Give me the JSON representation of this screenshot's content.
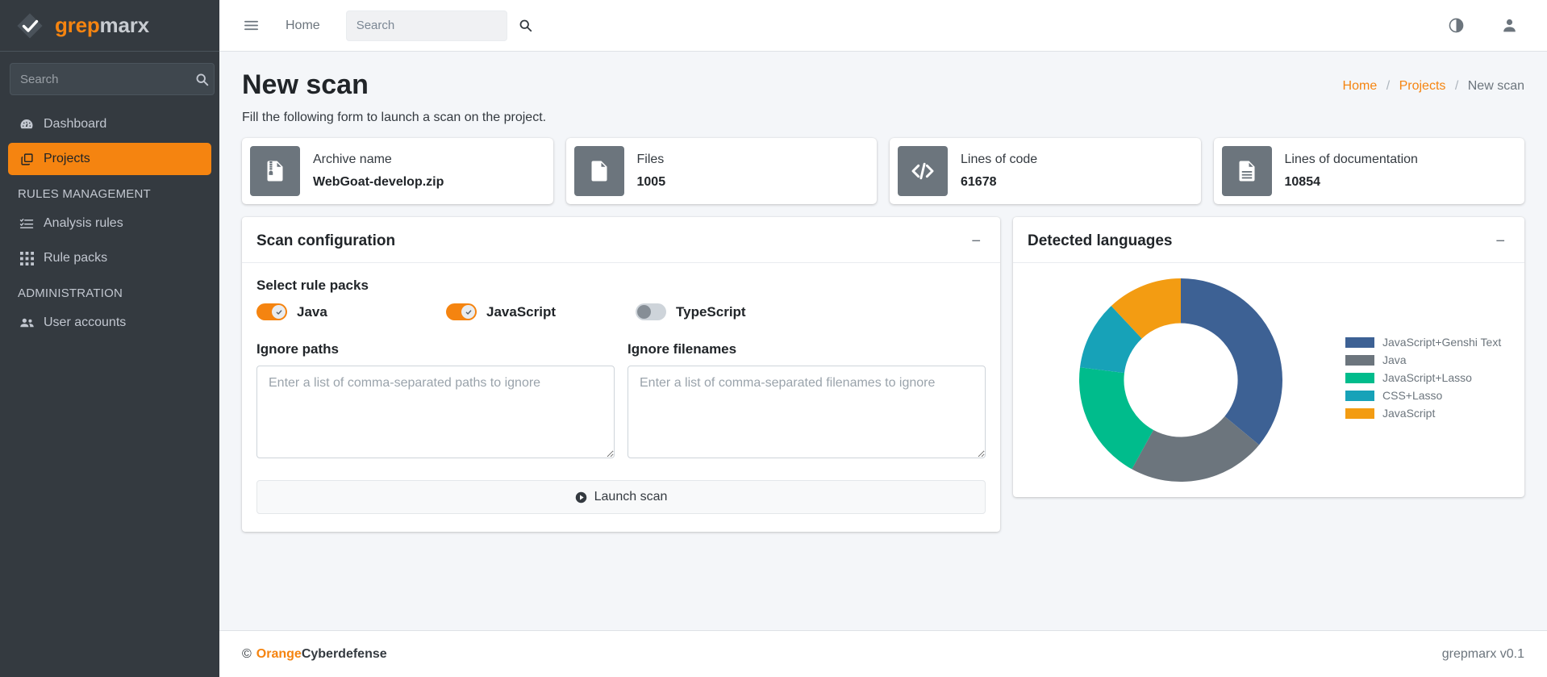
{
  "brand": {
    "prefix": "grep",
    "suffix": "marx",
    "logo_icon": "diamond-check-icon"
  },
  "sidebar": {
    "search": {
      "placeholder": "Search",
      "value": "",
      "icon": "search-icon"
    },
    "items": [
      {
        "label": "Dashboard",
        "icon": "tachometer-icon",
        "active": false
      },
      {
        "label": "Projects",
        "icon": "copy-icon",
        "active": true
      }
    ],
    "section_rules": "RULES MANAGEMENT",
    "rules_items": [
      {
        "label": "Analysis rules",
        "icon": "list-check-icon"
      },
      {
        "label": "Rule packs",
        "icon": "grid-icon"
      }
    ],
    "section_admin": "ADMINISTRATION",
    "admin_items": [
      {
        "label": "User accounts",
        "icon": "users-icon"
      }
    ]
  },
  "navbar": {
    "menu_icon": "hamburger-icon",
    "home_label": "Home",
    "search": {
      "placeholder": "Search",
      "value": "",
      "icon": "search-icon"
    },
    "theme_icon": "contrast-circle-icon",
    "user_icon": "user-icon"
  },
  "page": {
    "title": "New scan",
    "subtitle": "Fill the following form to launch a scan on the project.",
    "breadcrumb": [
      {
        "label": "Home",
        "link": true
      },
      {
        "label": "Projects",
        "link": true
      },
      {
        "label": "New scan",
        "link": false
      }
    ]
  },
  "info_cards": [
    {
      "icon": "file-archive-icon",
      "label": "Archive name",
      "value": "WebGoat-develop.zip"
    },
    {
      "icon": "file-icon",
      "label": "Files",
      "value": "1005"
    },
    {
      "icon": "code-icon",
      "label": "Lines of code",
      "value": "61678"
    },
    {
      "icon": "file-lines-icon",
      "label": "Lines of documentation",
      "value": "10854"
    }
  ],
  "scan_config": {
    "title": "Scan configuration",
    "collapse_icon": "minus-icon",
    "rule_packs_label": "Select rule packs",
    "rule_packs": [
      {
        "label": "Java",
        "on": true
      },
      {
        "label": "JavaScript",
        "on": true
      },
      {
        "label": "TypeScript",
        "on": false
      }
    ],
    "ignore_paths": {
      "label": "Ignore paths",
      "placeholder": "Enter a list of comma-separated paths to ignore",
      "value": ""
    },
    "ignore_filenames": {
      "label": "Ignore filenames",
      "placeholder": "Enter a list of comma-separated filenames to ignore",
      "value": ""
    },
    "launch_label": "Launch scan",
    "launch_icon": "play-circle-icon"
  },
  "languages_panel": {
    "title": "Detected languages",
    "collapse_icon": "minus-icon"
  },
  "chart_data": {
    "type": "pie",
    "title": "Detected languages",
    "donut": true,
    "hole": 0.56,
    "legend_position": "right",
    "categories": [
      "JavaScript+Genshi Text",
      "Java",
      "JavaScript+Lasso",
      "CSS+Lasso",
      "JavaScript"
    ],
    "values": [
      36,
      22,
      19,
      11,
      12
    ],
    "unit": "percent",
    "colors": [
      "#3d6194",
      "#6c757d",
      "#00bc8c",
      "#17a2b8",
      "#f39c12"
    ]
  },
  "footer": {
    "copyright": "©",
    "brand_orange": "Orange",
    "brand_dark": "Cyberdefense",
    "version": "grepmarx v0.1"
  }
}
